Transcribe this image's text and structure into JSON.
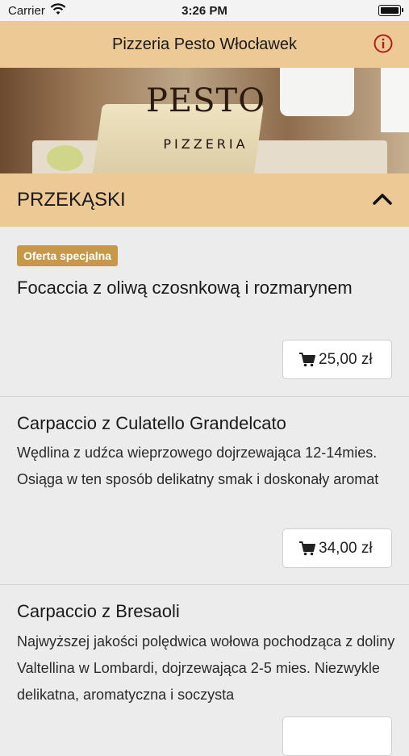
{
  "status": {
    "carrier": "Carrier",
    "time": "3:26 PM"
  },
  "nav": {
    "title": "Pizzeria Pesto Włocławek",
    "info_icon": "info-icon"
  },
  "hero": {
    "logo_top": "PESTO",
    "logo_bottom": "PIZZERIA"
  },
  "category": {
    "label": "PRZEKĄSKI",
    "icon": "chevron-up-icon"
  },
  "items": [
    {
      "badge": "Oferta specjalna",
      "name": "Focaccia z oliwą czosnkową i rozmarynem",
      "price": "25,00 zł"
    },
    {
      "name": "Carpaccio z Culatello Grandelcato",
      "desc": "Wędlina z udźca wieprzowego dojrzewająca 12-14mies. Osiąga w ten sposób delikatny smak i doskonały aromat",
      "price": "34,00 zł"
    },
    {
      "name": "Carpaccio z Bresaoli",
      "desc": "Najwyższej jakości polędwica wołowa pochodząca z doliny Valtellina w Lombardi, dojrzewająca 2-5 mies. Niezwykle delikatna, aromatyczna i soczysta"
    }
  ],
  "colors": {
    "accent": "#ecc995",
    "badge": "#c79849",
    "info": "#b01f1f"
  }
}
